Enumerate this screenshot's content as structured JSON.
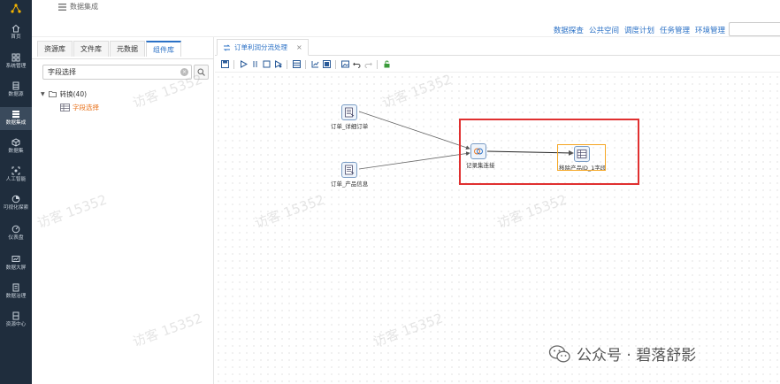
{
  "nav": {
    "items": [
      {
        "label": "首页",
        "icon": "home-icon"
      },
      {
        "label": "系统管理",
        "icon": "grid-icon"
      },
      {
        "label": "数据源",
        "icon": "database-icon"
      },
      {
        "label": "数据集成",
        "icon": "integration-icon",
        "active": true
      },
      {
        "label": "数据集",
        "icon": "cube-icon"
      },
      {
        "label": "人工智能",
        "icon": "ai-icon"
      },
      {
        "label": "可视化探索",
        "icon": "pie-icon"
      },
      {
        "label": "仪表盘",
        "icon": "gauge-icon"
      },
      {
        "label": "数据大屏",
        "icon": "screen-icon"
      },
      {
        "label": "数据治理",
        "icon": "governance-icon"
      },
      {
        "label": "资源中心",
        "icon": "resource-icon"
      }
    ]
  },
  "header": {
    "breadcrumb": "数据集成",
    "menu": [
      "数据探查",
      "公共空间",
      "调度计划",
      "任务管理",
      "环境管理"
    ]
  },
  "left_panel": {
    "tabs": [
      "资源库",
      "文件库",
      "元数据",
      "组件库"
    ],
    "active_tab": 3,
    "search_value": "字段选择",
    "tree": {
      "root_label": "转换(40)",
      "child_label": "字段选择"
    }
  },
  "editor": {
    "tab_label": "订单利润分流处理",
    "nodes": {
      "detail": "订单_详细订单",
      "product": "订单_产品信息",
      "merge": "记录集连接",
      "select": "移除产品ID_1字段"
    }
  },
  "watermark": "访客 15352",
  "brand": "公众号 · 碧落舒影",
  "colors": {
    "nav_bg": "#1f2d3d",
    "accent": "#2b71c6",
    "highlight_red": "#e03030",
    "highlight_orange": "#f5a623",
    "tree_child": "#e8711a"
  }
}
